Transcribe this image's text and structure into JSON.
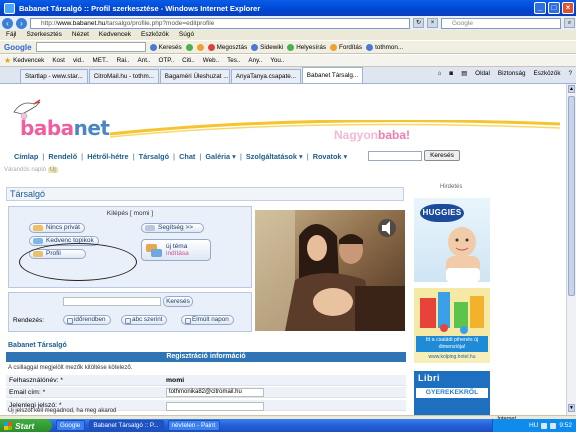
{
  "window": {
    "title": "Babanet Társalgó :: Profil szerkesztése - Windows Internet Explorer",
    "minimize": "_",
    "maximize": "□",
    "close": "×"
  },
  "address": {
    "url_host": "www.babanet.hu",
    "url_path": "/tarsalgo/profile.php?mode=editprofile",
    "url_prefix": "http://",
    "search_placeholder": "Google"
  },
  "menu": [
    "Fájl",
    "Szerkesztés",
    "Nézet",
    "Kedvencek",
    "Eszközök",
    "Súgó"
  ],
  "google_toolbar": {
    "logo": "Google",
    "items": [
      "Keresés",
      "Megosztás",
      "Sidewiki",
      "Helyesírás",
      "Fordítás",
      "tothmon..."
    ]
  },
  "favorites": {
    "label": "Kedvencek",
    "items": [
      "Kost",
      "vid..",
      "MET..",
      "Rai..",
      "Ant..",
      "OTP..",
      "Citi..",
      "Web..",
      "Tes..",
      "Any..",
      "You.."
    ]
  },
  "tabs": [
    {
      "label": "Startlap - www.star..."
    },
    {
      "label": "CitroMail.hu - tothm..."
    },
    {
      "label": "Bagaméri Úleshuzat ..."
    },
    {
      "label": "AnyaTanya.csapate..."
    },
    {
      "label": "Babanet Társalg..."
    }
  ],
  "tab_tools": [
    "Oldal",
    "Biztonság",
    "Eszközök",
    "?"
  ],
  "site": {
    "logo_part1": "baba",
    "logo_part2": "net",
    "slogan_part1": "Nagyon",
    "slogan_part2": "baba!",
    "nav": [
      {
        "label": "Címlap"
      },
      {
        "label": "Rendelő"
      },
      {
        "label": "Hétről-hétre"
      },
      {
        "label": "Társalgó"
      },
      {
        "label": "Chat"
      },
      {
        "label": "Galéria",
        "caret": true
      },
      {
        "label": "Szolgáltatások",
        "caret": true
      },
      {
        "label": "Rovatok",
        "caret": true
      }
    ],
    "search_button": "Keresés",
    "subbar_text": "Várandós napló",
    "subbar_badge": "Új"
  },
  "forum": {
    "section_title": "Társalgó",
    "login_head": "Kilépés [ momi ]",
    "links": {
      "no_private": "Nincs privát",
      "favorite_topics": "Kedvenc topikok",
      "profile": "Profil",
      "help": "Segítség >>",
      "new_topic_l1": "új téma",
      "new_topic_l2": "indítása"
    },
    "search_button": "Keresés",
    "sort_label": "Rendezés:",
    "sort_options": [
      "időrendben",
      "abc szerint",
      "Elmúlt napon"
    ]
  },
  "ads": {
    "label": "Hirdetés",
    "huggies": "HUGGIES",
    "ad2_text": "Itt a családi pihenés új dimenziója!",
    "ad2_url": "www.kolping.hotel.hu",
    "libri": "Libri",
    "libri_tag": "GYEREKEKRŐL"
  },
  "registration": {
    "breadcrumb": "Babanet Társalgó",
    "header": "Regisztráció információ",
    "note": "A csillaggal megjelölt mezők kitöltése kötelező.",
    "username_label": "Felhasználónév: *",
    "username_value": "momi",
    "email_label": "Email cím: *",
    "email_value": "tothmonika82@citromail.hu",
    "password_label": "Jelenlegi jelszó: *",
    "password_hint": "Új jelszót kell megadnod, ha meg akarod"
  },
  "statusbar": {
    "zone": "Internet"
  },
  "taskbar": {
    "start": "Start",
    "buttons": [
      "Google",
      "Babanet Társalgó :: P...",
      "névtelen - Paint"
    ],
    "lang": "HU",
    "clock": "9:52"
  }
}
